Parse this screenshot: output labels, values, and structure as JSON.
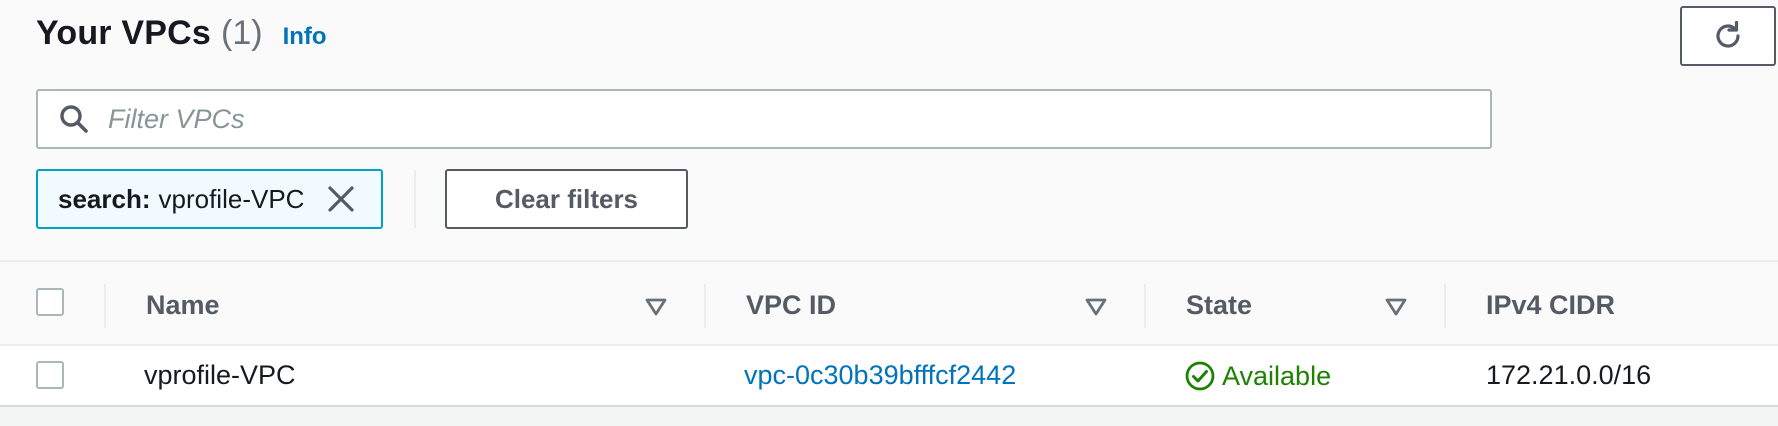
{
  "header": {
    "title": "Your VPCs",
    "count": "(1)",
    "info_label": "Info"
  },
  "refresh": {
    "icon": "refresh-icon"
  },
  "filter": {
    "placeholder": "Filter VPCs",
    "value": "",
    "icon": "search-icon"
  },
  "token": {
    "key": "search:",
    "value": "vprofile-VPC",
    "close_icon": "close-icon"
  },
  "clear_filters_label": "Clear filters",
  "table": {
    "columns": [
      {
        "label": "Name",
        "sortable": true
      },
      {
        "label": "VPC ID",
        "sortable": true
      },
      {
        "label": "State",
        "sortable": true
      },
      {
        "label": "IPv4 CIDR",
        "sortable": false
      }
    ],
    "rows": [
      {
        "selected": false,
        "name": "vprofile-VPC",
        "vpc_id": "vpc-0c30b39bfffcf2442",
        "state": "Available",
        "state_icon": "check-circle-icon",
        "ipv4_cidr": "172.21.0.0/16"
      }
    ]
  },
  "colors": {
    "link": "#0073bb",
    "success": "#1d8102",
    "token_border": "#00a1c9",
    "token_bg": "#f1faff",
    "heading_gray": "#545b64"
  }
}
